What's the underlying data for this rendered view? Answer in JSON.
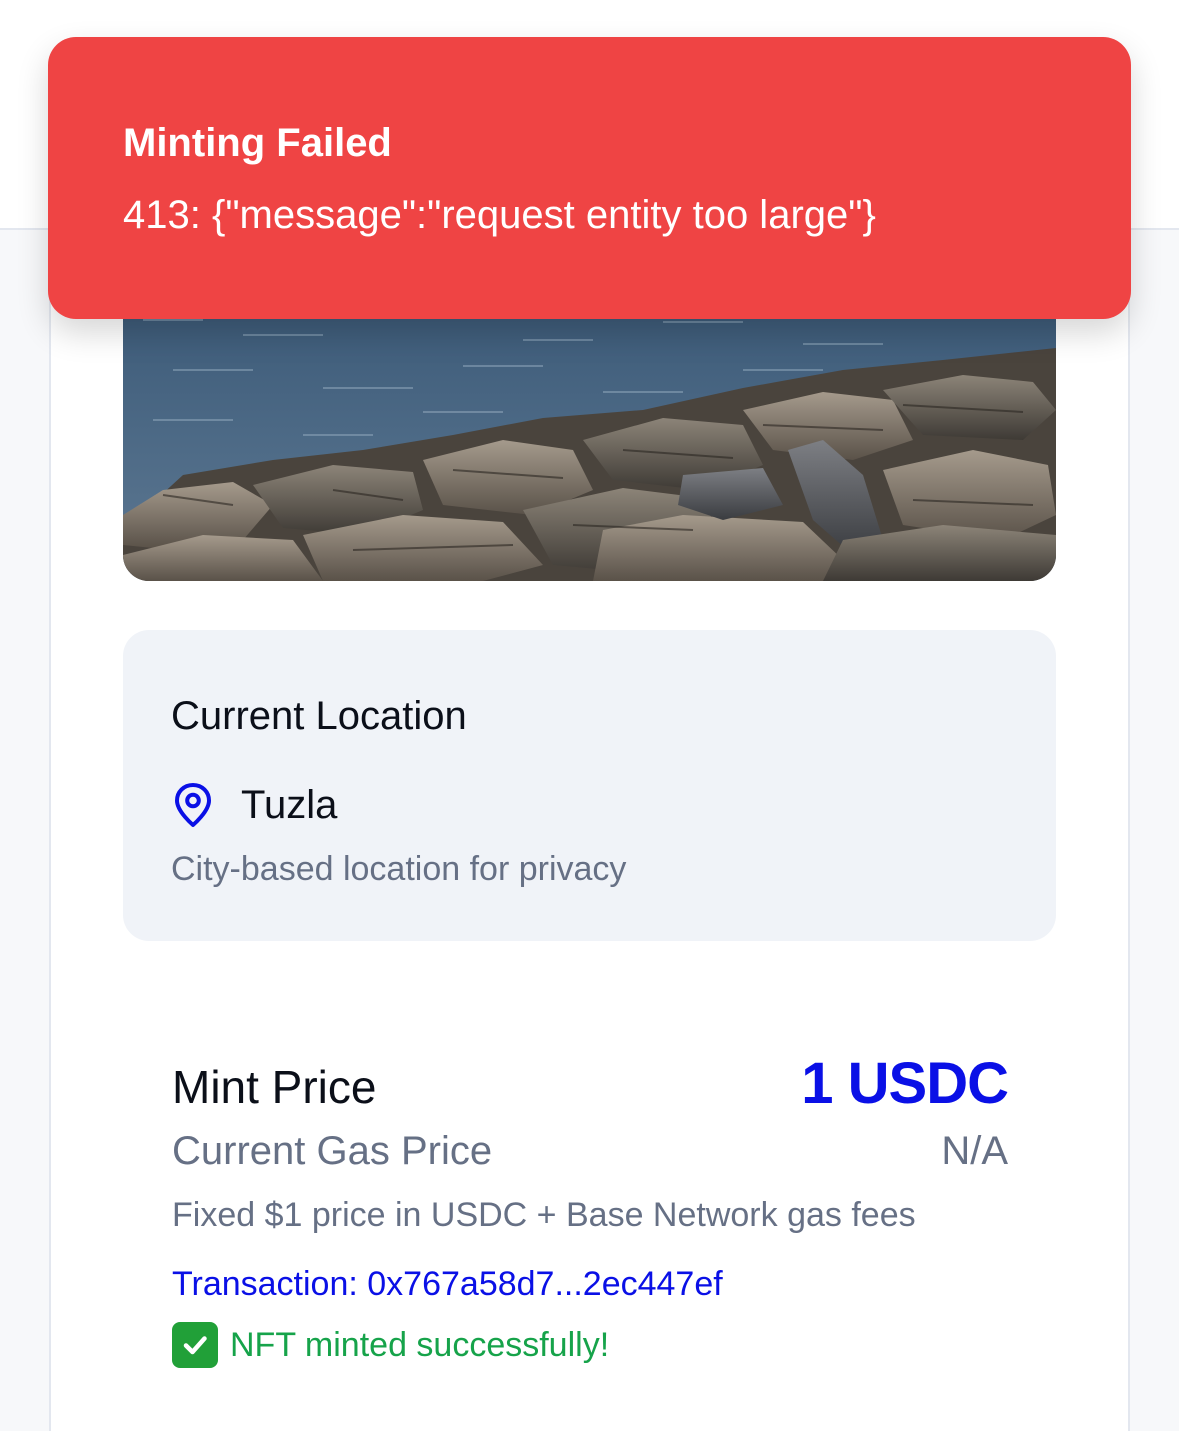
{
  "toast": {
    "title": "Minting Failed",
    "message": "413: {\"message\":\"request entity too large\"}",
    "color": "#ef4444"
  },
  "photo": {
    "description_icon": "photo-image"
  },
  "location": {
    "title": "Current Location",
    "icon": "map-pin-icon",
    "city": "Tuzla",
    "note": "City-based location for privacy"
  },
  "mint": {
    "price_label": "Mint Price",
    "price_value": "1 USDC",
    "gas_label": "Current Gas Price",
    "gas_value": "N/A",
    "fee_note": "Fixed $1 price in USDC + Base Network gas fees",
    "transaction": "Transaction: 0x767a58d7...2ec447ef",
    "success_icon": "check-mark-icon",
    "success_text": "NFT minted successfully!"
  },
  "colors": {
    "accent": "#0a10e6",
    "error": "#ef4444",
    "success": "#16a34a",
    "muted": "#667085"
  }
}
